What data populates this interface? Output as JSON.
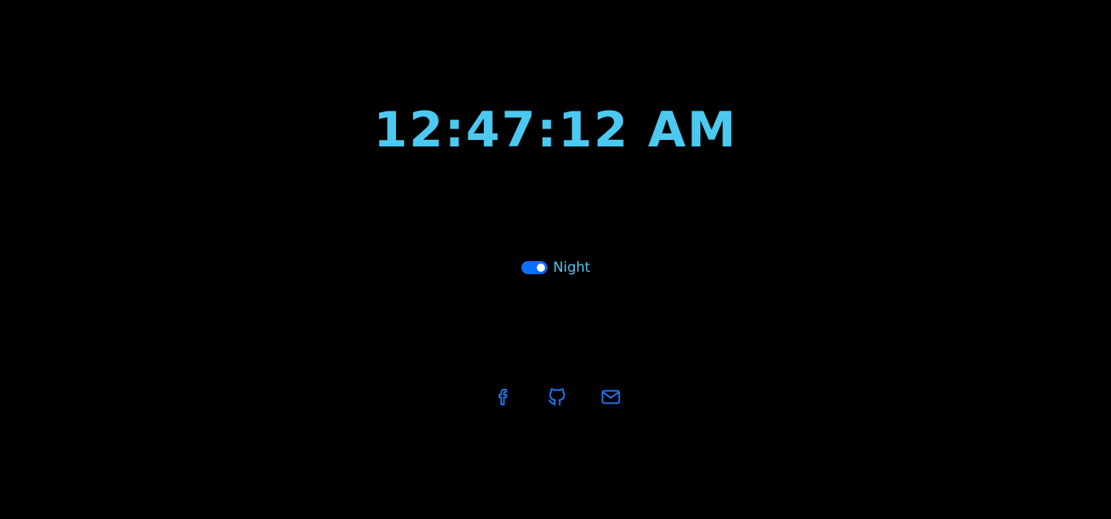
{
  "clock": {
    "time": "12:47:12 AM"
  },
  "theme": {
    "enabled": true,
    "label": "Night"
  },
  "social_links": [
    {
      "icon": "facebook-icon"
    },
    {
      "icon": "github-icon"
    },
    {
      "icon": "mail-icon"
    }
  ],
  "colors": {
    "background": "#000000",
    "text_accent": "#4cc9f0",
    "toggle_accent": "#0d6efd",
    "icon_color": "#1f7cff"
  }
}
